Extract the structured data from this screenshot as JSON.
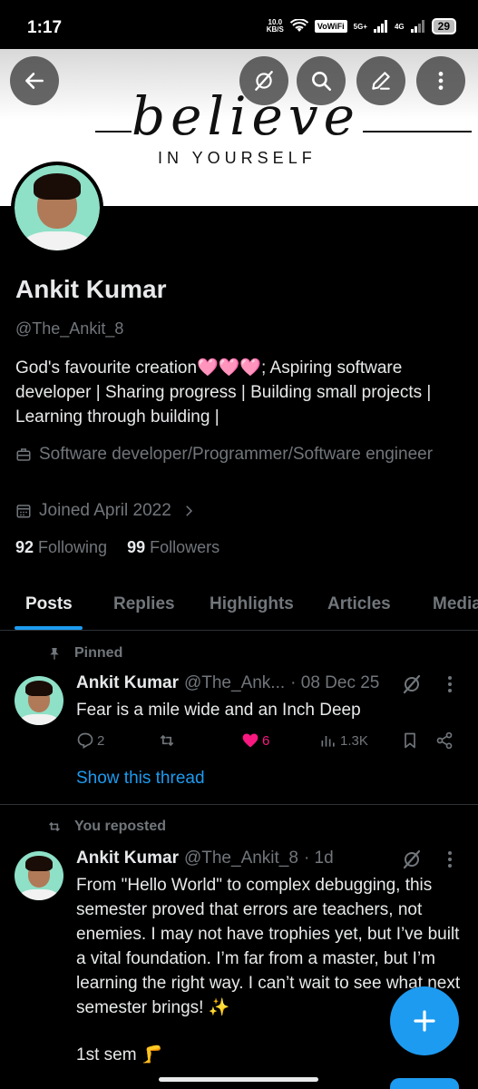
{
  "status_bar": {
    "time": "1:17",
    "net_speed_value": "10.0",
    "net_speed_unit": "KB/S",
    "vowifi": "VoWiFi",
    "sim1_label": "5G+",
    "sim2_label": "4G",
    "battery": "29"
  },
  "banner": {
    "script_text": "believe",
    "sub_text": "IN YOURSELF"
  },
  "profile": {
    "name": "Ankit Kumar",
    "handle": "@The_Ankit_8",
    "bio": "God's favourite creation🩷🩷🩷; Aspiring software developer | Sharing progress | Building small projects | Learning through building |",
    "profession": "Software developer/Programmer/Software engineer",
    "joined": "Joined April 2022",
    "following_count": "92",
    "following_label": "Following",
    "followers_count": "99",
    "followers_label": "Followers"
  },
  "tabs": [
    "Posts",
    "Replies",
    "Highlights",
    "Articles",
    "Media"
  ],
  "posts": [
    {
      "context_label": "Pinned",
      "author": "Ankit Kumar",
      "handle": "@The_Ank...",
      "time": "· 08 Dec 25",
      "text": "Fear is a mile wide and an Inch Deep",
      "replies": "2",
      "likes": "6",
      "views": "1.3K",
      "show_thread": "Show this thread"
    },
    {
      "context_label": "You reposted",
      "author": "Ankit Kumar",
      "handle": "@The_Ankit_8",
      "time": "· 1d",
      "text_p1": "From \"Hello World\" to complex debugging, this semester proved that errors are teachers, not enemies. I may not have trophies yet, but I’ve built a vital foundation. I’m far from a master, but I’m learning the right way. I can’t wait to see what next semester brings! ✨",
      "text_p2": "1st sem 🦵"
    }
  ],
  "colors": {
    "accent": "#1d9bf0",
    "like": "#f91880",
    "muted": "#71767b",
    "text": "#e7e9ea",
    "background": "#000000"
  }
}
